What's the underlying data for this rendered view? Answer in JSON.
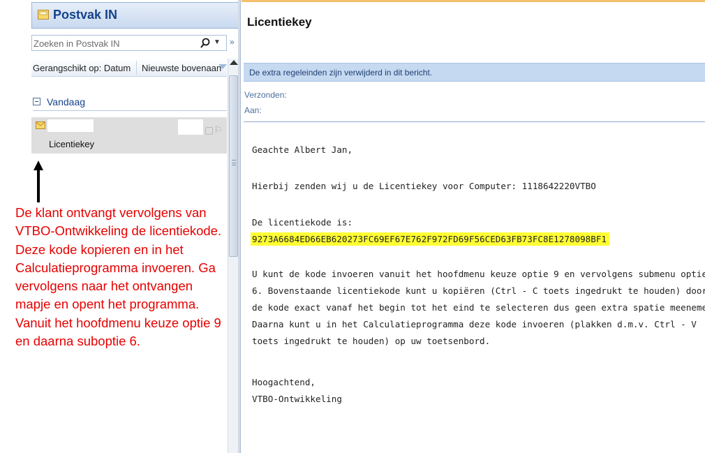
{
  "left": {
    "title": "Postvak IN",
    "search": {
      "placeholder": "Zoeken in Postvak IN"
    },
    "sort": {
      "label": "Gerangschikt op: Datum",
      "order": "Nieuwste bovenaan"
    },
    "group": {
      "label": "Vandaag"
    },
    "mail_item": {
      "subject": "Licentiekey"
    }
  },
  "annotation": {
    "lines": [
      "De klant ontvangt vervolgens van",
      "VTBO-Ontwikkeling de licentiekode.",
      "Deze kode kopieren en in het",
      "Calculatieprogramma invoeren. Ga",
      "vervolgens naar het ontvangen",
      "mapje en opent het programma.",
      "Vanuit het hoofdmenu keuze optie 9",
      "en daarna suboptie 6."
    ],
    "color": "#e60000"
  },
  "message": {
    "title": "Licentiekey",
    "info": "De extra regeleinden zijn verwijderd in dit bericht.",
    "sent_label": "Verzonden:",
    "to_label": "Aan:",
    "greeting": "Geachte Albert Jan,",
    "intro": "Hierbij zenden wij u de Licentiekey voor Computer: 1118642220VTBO",
    "code_label": "De licentiekode is:",
    "code": "9273A6684ED66EB620273FC69EF67E762F972FD69F56CED63FB73FC8E1278098BF1",
    "instructions": [
      "U kunt de kode invoeren vanuit het hoofdmenu keuze optie 9 en vervolgens submenu optie",
      "6. Bovenstaande licentiekode kunt u kopiëren (Ctrl - C toets ingedrukt te houden) door",
      "de kode exact vanaf het begin tot het eind te selecteren dus geen extra spatie meenemen.",
      "Daarna kunt u in het Calculatieprogramma deze kode invoeren (plakken d.m.v. Ctrl - V",
      "toets ingedrukt te houden) op uw toetsenbord."
    ],
    "closing": "Hoogachtend,",
    "signature": "VTBO-Ontwikkeling"
  },
  "colors": {
    "highlight": "#ffff33",
    "accent": "#15428b"
  }
}
